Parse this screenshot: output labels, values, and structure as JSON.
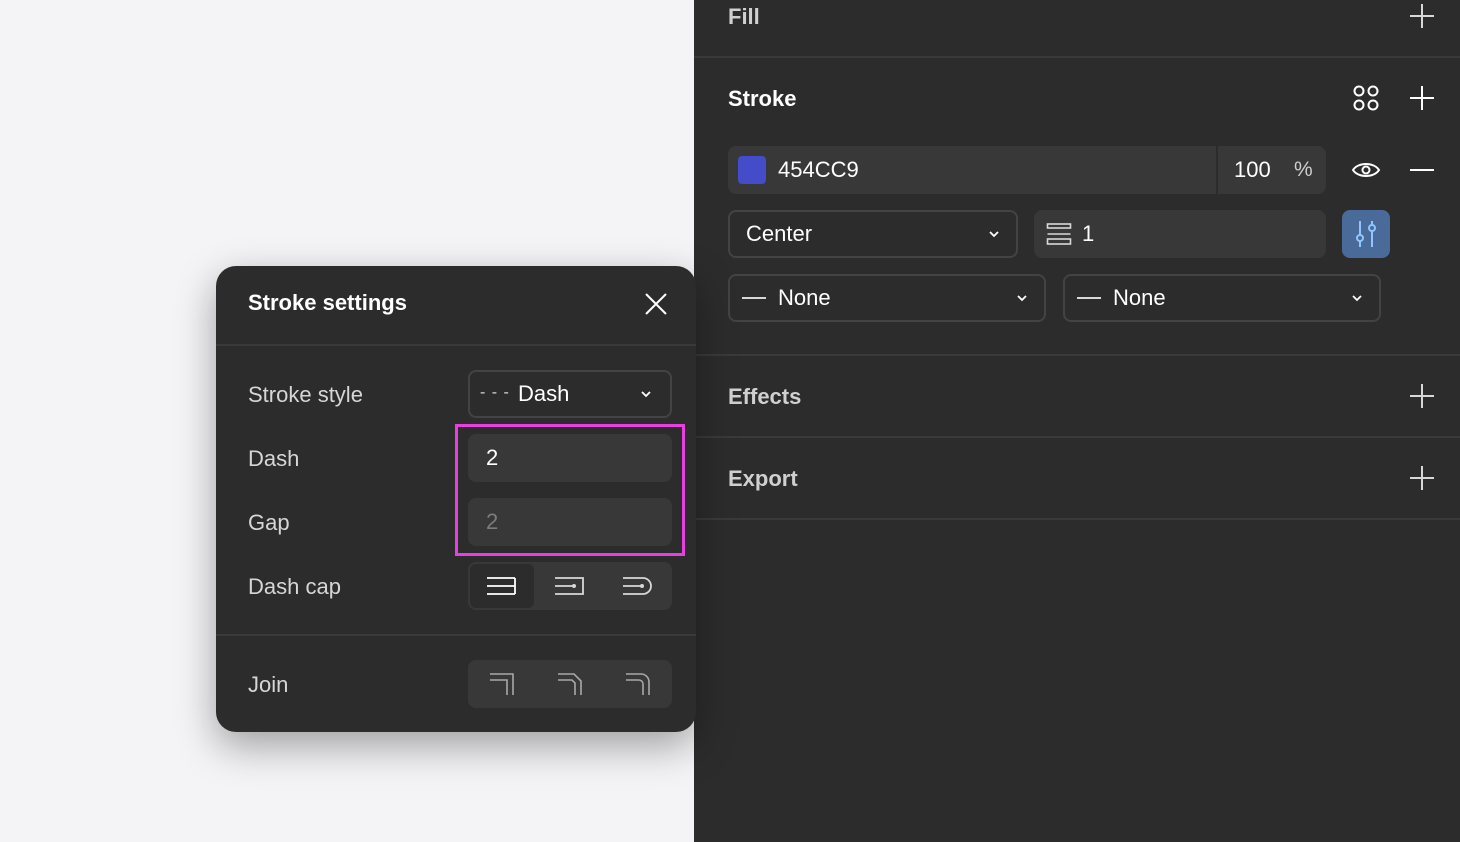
{
  "panel": {
    "fill": {
      "title": "Fill"
    },
    "stroke": {
      "title": "Stroke",
      "color_hex": "454CC9",
      "swatch_color": "#454CC9",
      "opacity": "100",
      "opacity_unit": "%",
      "position": "Center",
      "weight": "1",
      "start_cap": "None",
      "end_cap": "None"
    },
    "effects": {
      "title": "Effects"
    },
    "export": {
      "title": "Export"
    }
  },
  "popover": {
    "title": "Stroke settings",
    "stroke_style_label": "Stroke style",
    "stroke_style_dashes": "- - -",
    "stroke_style_value": "Dash",
    "dash_label": "Dash",
    "dash_value": "2",
    "gap_label": "Gap",
    "gap_placeholder": "2",
    "dash_cap_label": "Dash cap",
    "join_label": "Join"
  },
  "colors": {
    "accent": "#4a6a99",
    "highlight": "#e83fe0",
    "panel_bg": "#2c2c2c"
  }
}
